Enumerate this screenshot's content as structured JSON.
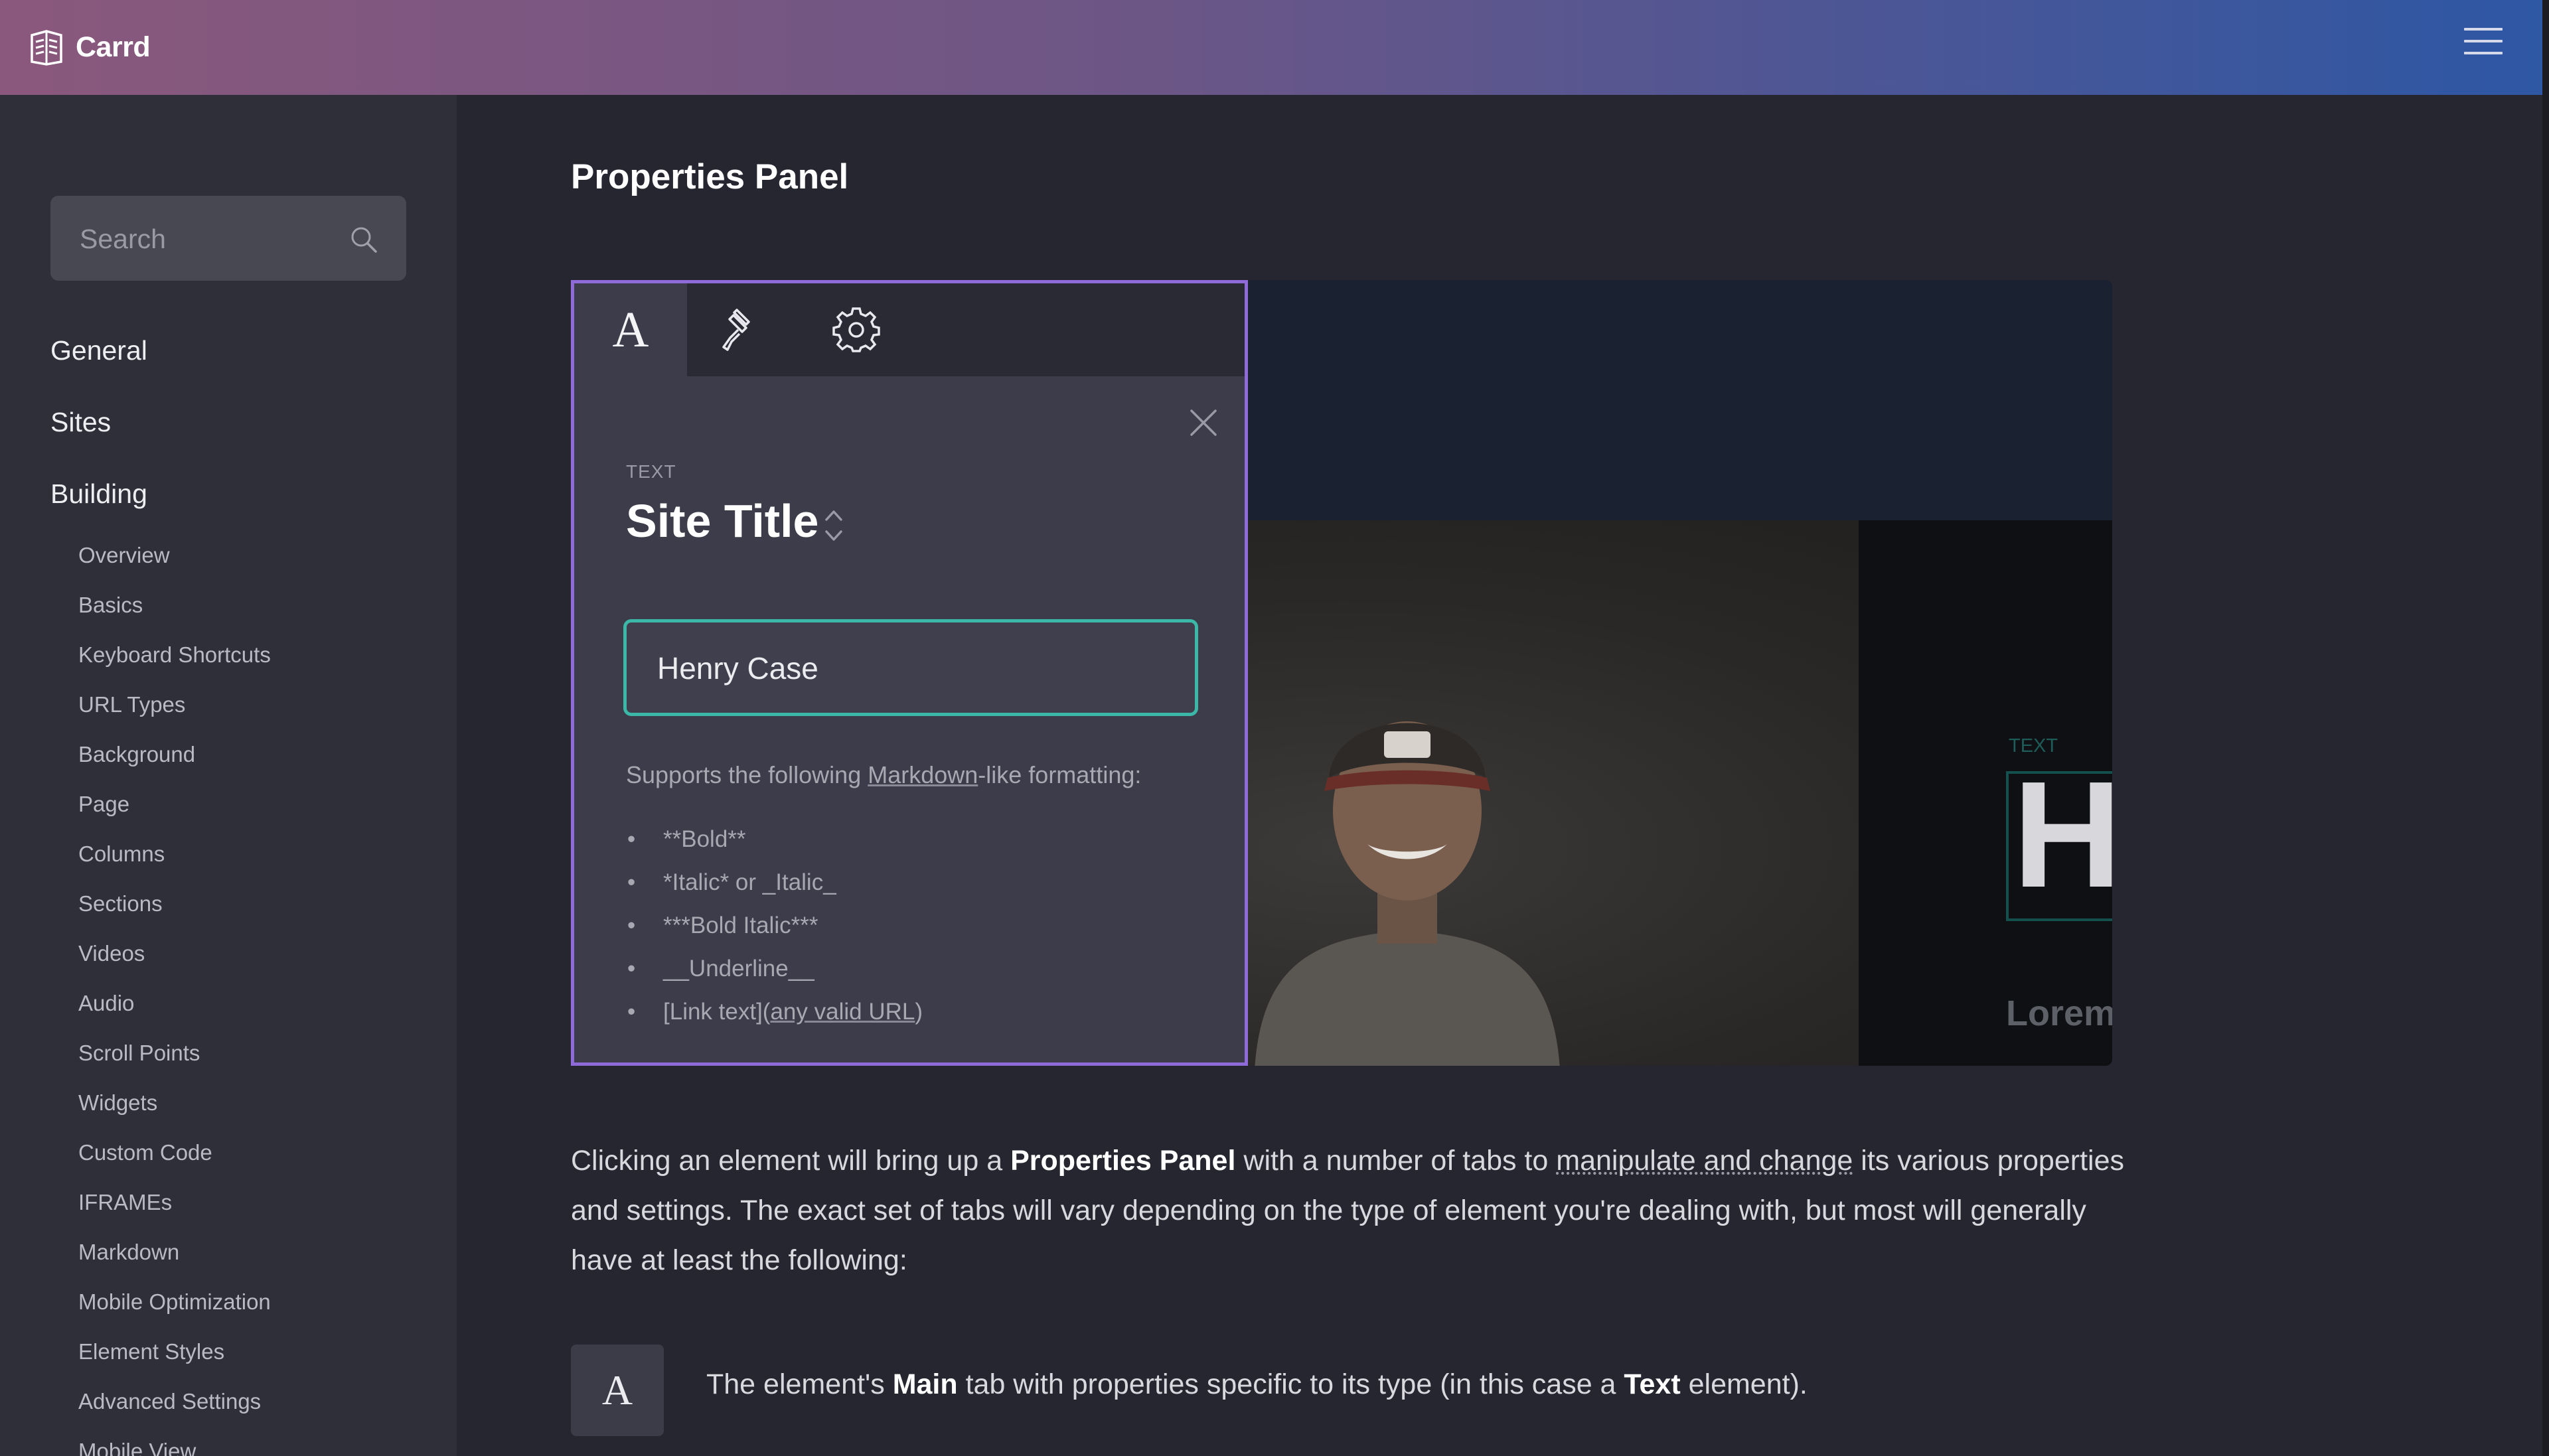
{
  "header": {
    "brand": "Carrd",
    "menu_icon": "hamburger-menu-icon"
  },
  "sidebar": {
    "search": {
      "placeholder": "Search",
      "value": ""
    },
    "top_items": [
      "General",
      "Sites",
      "Building"
    ],
    "building_items": [
      "Overview",
      "Basics",
      "Keyboard Shortcuts",
      "URL Types",
      "Background",
      "Page",
      "Columns",
      "Sections",
      "Videos",
      "Audio",
      "Scroll Points",
      "Widgets",
      "Custom Code",
      "IFRAMEs",
      "Markdown",
      "Mobile Optimization",
      "Element Styles",
      "Advanced Settings",
      "Mobile View"
    ]
  },
  "main": {
    "title": "Properties Panel",
    "panel": {
      "tabs": [
        {
          "label": "A",
          "icon": "text-main-icon",
          "active": true
        },
        {
          "label": "",
          "icon": "paintbrush-icon",
          "active": false
        },
        {
          "label": "",
          "icon": "gear-icon",
          "active": false
        }
      ],
      "type_label": "TEXT",
      "element_name": "Site Title",
      "input_value": "Henry Case",
      "help_prefix": "Supports the following ",
      "help_link": "Markdown",
      "help_suffix": "-like formatting:",
      "formats": [
        "**Bold**",
        "*Italic* or _Italic_",
        "***Bold Italic***",
        "__Underline__"
      ],
      "link_format_prefix": "[Link text](",
      "link_format_link": "any valid URL",
      "link_format_suffix": ")"
    },
    "preview": {
      "text_label": "TEXT",
      "heading_glyph": "H",
      "lorem": "Lorem"
    },
    "paragraph": {
      "p1": "Clicking an element will bring up a ",
      "p1_bold": "Properties Panel",
      "p2": " with a number of tabs to ",
      "p2_link": "manipulate and change",
      "p3": " its various properties and settings. The exact set of tabs will vary depending on the type of element you're dealing with, but most will generally have at least the following:"
    },
    "feature": {
      "icon_glyph": "A",
      "t1": "The element's ",
      "t1_bold": "Main",
      "t2": " tab with properties specific to its type (in this case a ",
      "t2_bold": "Text",
      "t3": " element)."
    }
  },
  "colors": {
    "accent_panel_border": "#8e6bd8",
    "input_border": "#3bb8a8",
    "sidebar_bg": "#2f2f39",
    "page_bg": "#262630"
  }
}
